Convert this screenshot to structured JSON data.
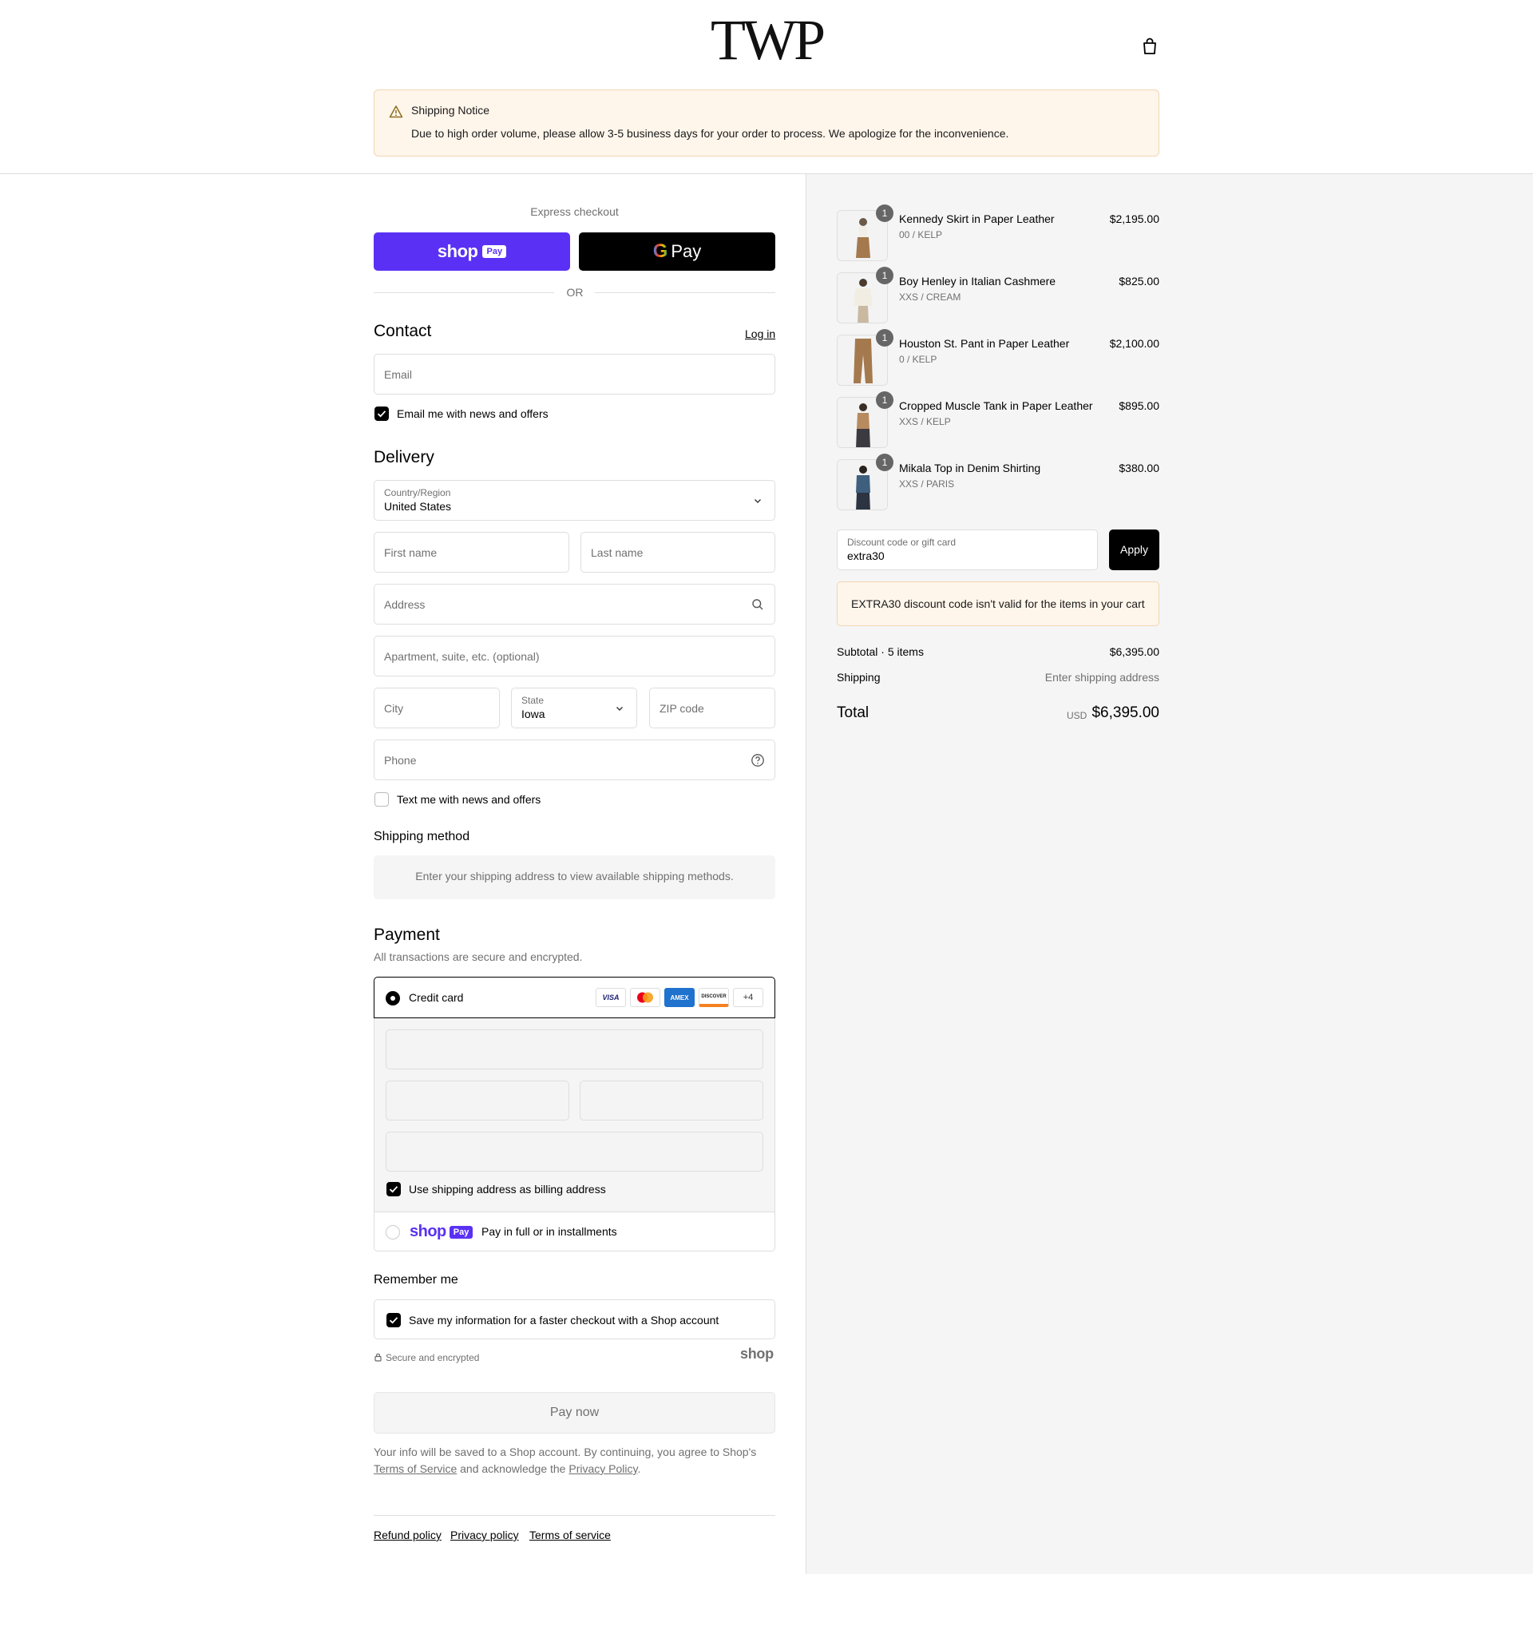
{
  "brand": {
    "logo": "TWP"
  },
  "notice": {
    "title": "Shipping Notice",
    "body": "Due to high order volume, please allow 3-5 business days for your order to process. We apologize for the inconvenience."
  },
  "express": {
    "label": "Express checkout",
    "shop_word": "shop",
    "shop_chip": "Pay",
    "gpay_g": "G",
    "gpay_word": "Pay",
    "or": "OR"
  },
  "contact": {
    "title": "Contact",
    "login": "Log in",
    "email_placeholder": "Email",
    "news_label": "Email me with news and offers"
  },
  "delivery": {
    "title": "Delivery",
    "country_label": "Country/Region",
    "country_value": "United States",
    "first_name": "First name",
    "last_name": "Last name",
    "address": "Address",
    "apartment": "Apartment, suite, etc. (optional)",
    "city": "City",
    "state_label": "State",
    "state_value": "Iowa",
    "zip": "ZIP code",
    "phone": "Phone",
    "text_label": "Text me with news and offers"
  },
  "shipping_method": {
    "title": "Shipping method",
    "message": "Enter your shipping address to view available shipping methods."
  },
  "payment": {
    "title": "Payment",
    "subtitle": "All transactions are secure and encrypted.",
    "credit_card": "Credit card",
    "cards": [
      "VISA",
      "",
      "AMEX",
      "DISCOVER",
      "+4"
    ],
    "billing_label": "Use shipping address as billing address",
    "shoppay_word": "shop",
    "shoppay_chip": "Pay",
    "shoppay_label": "Pay in full or in installments"
  },
  "remember": {
    "title": "Remember me",
    "label": "Save my information for a faster checkout with a Shop account",
    "secure": "Secure and encrypted",
    "shop_logo": "shop"
  },
  "pay_now": "Pay now",
  "legal": {
    "prefix": "Your info will be saved to a Shop account. By continuing, you agree to Shop's",
    "tos": "Terms of Service",
    "middle": "and acknowledge the",
    "privacy": "Privacy Policy",
    "suffix": "."
  },
  "footer": {
    "refund": "Refund policy",
    "privacy": "Privacy policy",
    "terms": "Terms of service"
  },
  "cart": {
    "items": [
      {
        "name": "Kennedy Skirt in Paper Leather",
        "variant": "00 / KELP",
        "price": "$2,195.00",
        "qty": "1"
      },
      {
        "name": "Boy Henley in Italian Cashmere",
        "variant": "XXS / CREAM",
        "price": "$825.00",
        "qty": "1"
      },
      {
        "name": "Houston St. Pant in Paper Leather",
        "variant": "0 / KELP",
        "price": "$2,100.00",
        "qty": "1"
      },
      {
        "name": "Cropped Muscle Tank in Paper Leather",
        "variant": "XXS / KELP",
        "price": "$895.00",
        "qty": "1"
      },
      {
        "name": "Mikala Top in Denim Shirting",
        "variant": "XXS / PARIS",
        "price": "$380.00",
        "qty": "1"
      }
    ],
    "discount_label": "Discount code or gift card",
    "discount_value": "extra30",
    "apply": "Apply",
    "error": "EXTRA30 discount code isn't valid for the items in your cart",
    "subtotal_label": "Subtotal · 5 items",
    "subtotal_value": "$6,395.00",
    "shipping_label": "Shipping",
    "shipping_value": "Enter shipping address",
    "total_label": "Total",
    "currency": "USD",
    "total_value": "$6,395.00"
  },
  "colors": {
    "shop_purple": "#5a31f4",
    "notice_bg": "#fff6eb",
    "summary_bg": "#f5f5f5"
  }
}
